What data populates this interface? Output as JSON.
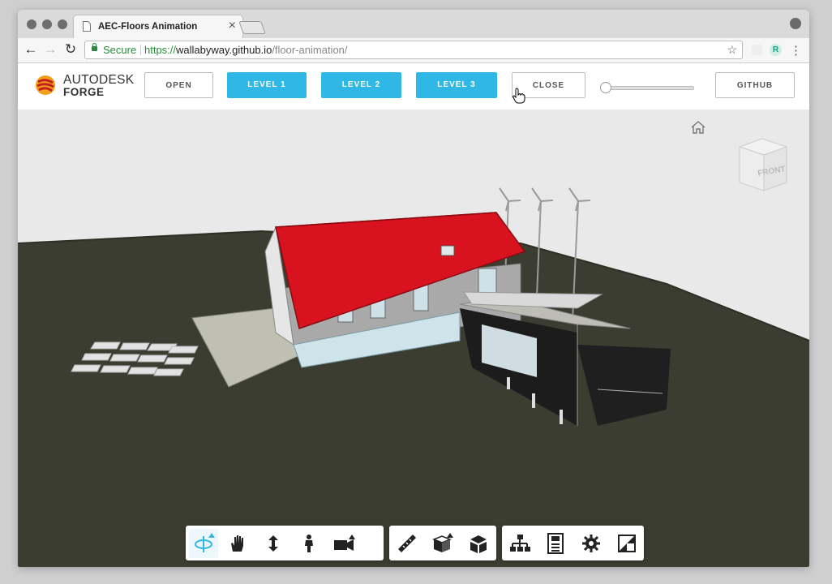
{
  "browser": {
    "tab_title": "AEC-Floors Animation",
    "tab_close": "×",
    "secure_label": "Secure",
    "url_scheme": "https://",
    "url_host": "wallabyway.github.io",
    "url_path": "/floor-animation/"
  },
  "app": {
    "logo_line1": "AUTODESK",
    "logo_line2": "FORGE",
    "buttons": {
      "open": "OPEN",
      "level1": "LEVEL 1",
      "level2": "LEVEL 2",
      "level3": "LEVEL 3",
      "close": "CLOSE",
      "github": "GITHUB"
    },
    "slider_value": 0
  },
  "viewer": {
    "viewcube_label": "FRONT",
    "toolbar_groups": [
      [
        "orbit-icon",
        "pan-icon",
        "dolly-icon",
        "first-person-icon",
        "camera-icon"
      ],
      [
        "measure-icon",
        "section-icon",
        "explode-icon"
      ],
      [
        "model-browser-icon",
        "properties-icon",
        "settings-icon",
        "fullscreen-icon"
      ]
    ]
  },
  "colors": {
    "accent": "#2fb7e5",
    "roof": "#d8121e",
    "ground": "#3a3c2f",
    "sky": "#e9e9e9"
  }
}
